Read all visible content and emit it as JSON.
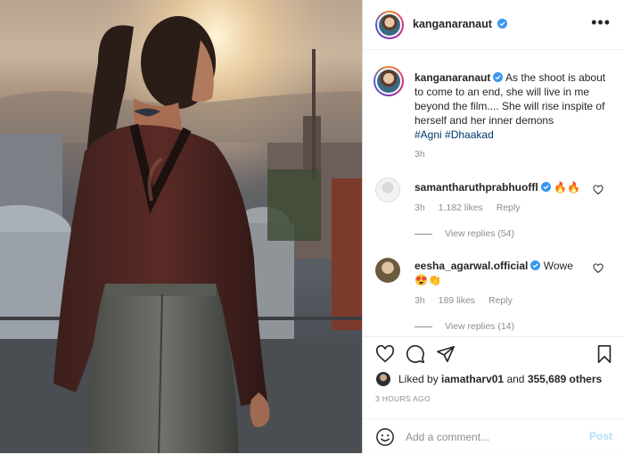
{
  "post": {
    "author": "kanganaranaut",
    "more_icon": "more-horizontal-icon",
    "caption": {
      "username": "kanganaranaut",
      "text": "As the shoot is about to come to an end, she will live in me beyond the film.... She will rise inspite of herself and her inner demons",
      "hashtags": [
        "#Agni",
        "#Dhaakad"
      ],
      "time": "3h"
    },
    "comments": [
      {
        "username": "samantharuthprabhuoffl",
        "text": "🔥🔥",
        "time": "3h",
        "likes": "1,182 likes",
        "reply": "Reply",
        "view_replies": "View replies (54)"
      },
      {
        "username": "eesha_agarwal.official",
        "text": "Wowe",
        "text2": "😍👏",
        "time": "3h",
        "likes": "189 likes",
        "reply": "Reply",
        "view_replies": "View replies (14)"
      }
    ],
    "liked_by": {
      "prefix": "Liked by",
      "user": "iamatharv01",
      "and": "and",
      "others": "355,689 others"
    },
    "timestamp": "3 HOURS AGO",
    "add_comment": {
      "placeholder": "Add a comment...",
      "post_label": "Post"
    }
  },
  "colors": {
    "verified": "#3897f0",
    "hashtag": "#00376b",
    "muted": "#8e8e8e",
    "post_button": "#b2dffc"
  }
}
